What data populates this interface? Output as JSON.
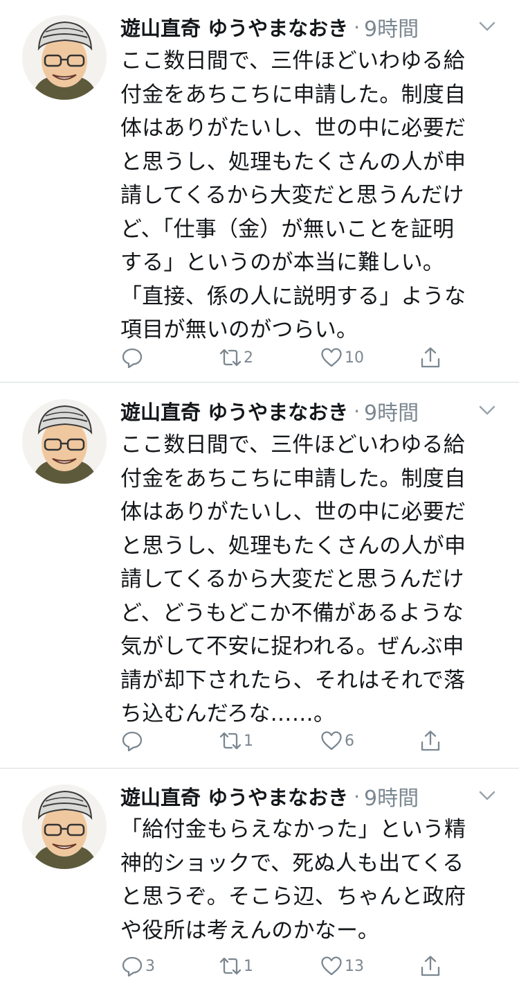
{
  "tweets": [
    {
      "author": "遊山直奇 ゆうやまなおき",
      "separator": "·",
      "time": "9時間",
      "text": "ここ数日間で、三件ほどいわゆる給\n付金をあちこちに申請した。制度自\n体はありがたいし、世の中に必要だ\nと思うし、処理もたくさんの人が申\n請してくるから大変だと思うんだけ\nど、「仕事（金）が無いことを証明\nする」というのが本当に難しい。\n「直接、係の人に説明する」ような\n項目が無いのがつらい。",
      "reply_count": "",
      "retweet_count": "2",
      "like_count": "10"
    },
    {
      "author": "遊山直奇 ゆうやまなおき",
      "separator": "·",
      "time": "9時間",
      "text": "ここ数日間で、三件ほどいわゆる給\n付金をあちこちに申請した。制度自\n体はありがたいし、世の中に必要だ\nと思うし、処理もたくさんの人が申\n請してくるから大変だと思うんだけ\nど、どうもどこか不備があるような\n気がして不安に捉われる。ぜんぶ申\n請が却下されたら、それはそれで落\nち込むんだろな……。",
      "reply_count": "",
      "retweet_count": "1",
      "like_count": "6"
    },
    {
      "author": "遊山直奇 ゆうやまなおき",
      "separator": "·",
      "time": "9時間",
      "text": "「給付金もらえなかった」という精\n神的ショックで、死ぬ人も出てくる\nと思うぞ。そこら辺、ちゃんと政府\nや役所は考えんのかなー。",
      "reply_count": "3",
      "retweet_count": "1",
      "like_count": "13"
    }
  ],
  "icons": {
    "reply": "reply-icon",
    "retweet": "retweet-icon",
    "like": "heart-icon",
    "share": "share-icon",
    "menu": "chevron-down-icon"
  },
  "colors": {
    "text": "#14171a",
    "secondary": "#7b8790",
    "divider": "#d6dbdf"
  }
}
